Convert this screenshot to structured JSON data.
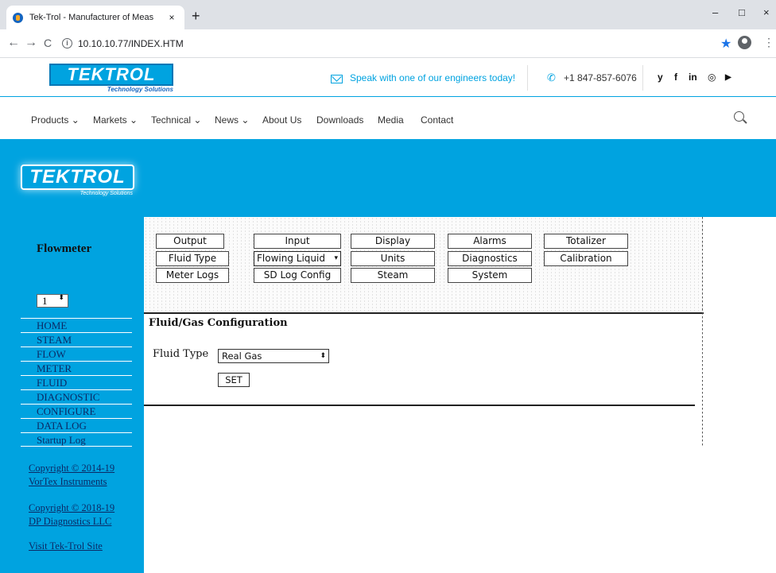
{
  "browser": {
    "tab_title": "Tek-Trol - Manufacturer of Meas",
    "tab_close": "×",
    "new_tab": "+",
    "controls": {
      "minimize": "–",
      "maximize": "□",
      "close": "×"
    },
    "back": "←",
    "forward": "→",
    "reload": "C",
    "info_icon": "i",
    "url": "10.10.10.77/INDEX.HTM",
    "star": "★",
    "menu": "⋮"
  },
  "header": {
    "logo_text": "TEKTROL",
    "logo_tagline": "Technology Solutions",
    "cta": "Speak with one of our engineers today!",
    "phone": "+1 847-857-6076",
    "phone_icon": "✆",
    "social": [
      "y",
      "f",
      "in",
      "◎",
      "▶"
    ]
  },
  "nav": {
    "items": [
      "Products ⌄",
      "Markets ⌄",
      "Technical ⌄",
      "News ⌄",
      "About Us",
      "Downloads",
      "Media",
      "Contact"
    ]
  },
  "banner": {
    "logo_text": "TEKTROL",
    "logo_tagline": "Technology Solutions"
  },
  "sidebar": {
    "title": "Flowmeter",
    "unit_value": "1",
    "unit_spin": "⬍",
    "links": [
      "HOME",
      "STEAM",
      "FLOW",
      "METER",
      "FLUID",
      "DIAGNOSTIC",
      "CONFIGURE",
      "DATA LOG",
      "Startup Log"
    ],
    "copyright1_line1": "Copyright © 2014-19",
    "copyright1_line2": "VorTex Instruments",
    "copyright2_line1": "Copyright © 2018-19",
    "copyright2_line2": "DP Diagnostics LLC",
    "visit": "Visit Tek-Trol Site"
  },
  "config": {
    "row1": [
      "Output",
      "Input",
      "Display",
      "Alarms",
      "Totalizer"
    ],
    "row2_btn1": "Fluid Type",
    "row2_select": "Flowing Liquid",
    "row2_rest": [
      "Units",
      "Diagnostics",
      "Calibration"
    ],
    "row3": [
      "Meter Logs",
      "SD Log Config",
      "Steam",
      "System"
    ],
    "select_arrow": "▾",
    "section_title": "Fluid/Gas Configuration",
    "field_label": "Fluid Type",
    "fluid_value": "Real Gas",
    "fluid_arrow": "⬍",
    "set_label": "SET"
  }
}
